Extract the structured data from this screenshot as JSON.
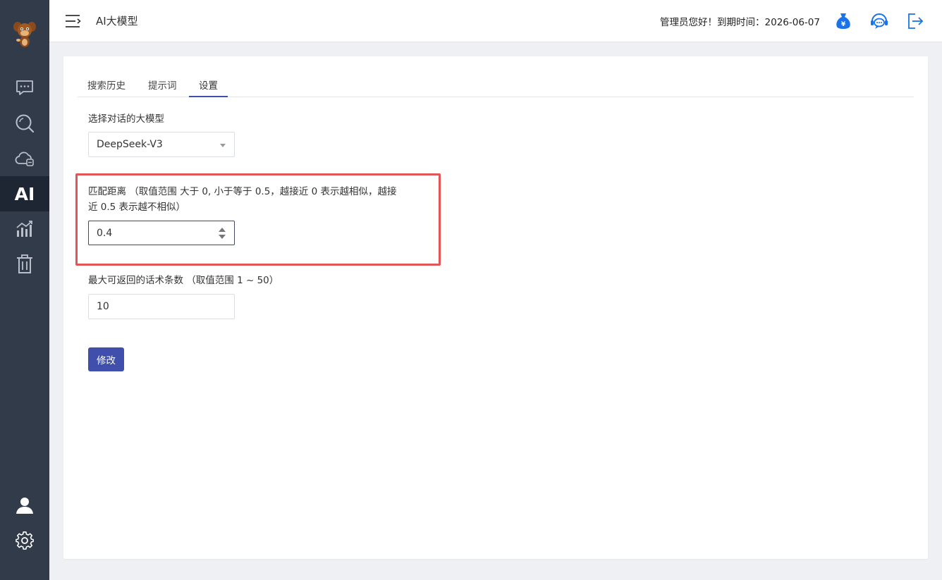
{
  "header": {
    "title": "AI大模型",
    "greeting": "管理员您好！到期时间：2026-06-07"
  },
  "sidebar": {
    "items": [
      {
        "icon": "chat-icon"
      },
      {
        "icon": "search-icon"
      },
      {
        "icon": "cloud-icon"
      },
      {
        "icon": "ai-icon",
        "label": "AI",
        "active": true
      },
      {
        "icon": "chart-icon"
      },
      {
        "icon": "trash-icon"
      }
    ],
    "bottom": [
      {
        "icon": "user-icon"
      },
      {
        "icon": "gear-icon"
      }
    ]
  },
  "tabs": [
    {
      "label": "搜索历史"
    },
    {
      "label": "提示词"
    },
    {
      "label": "设置",
      "active": true
    }
  ],
  "form": {
    "model_label": "选择对话的大模型",
    "model_value": "DeepSeek-V3",
    "distance_label_line1": "匹配距离 （取值范围 大于 0, 小于等于 0.5，越接近 0 表示越相似，越接",
    "distance_label_line2": "近 0.5 表示越不相似）",
    "distance_value": "0.4",
    "max_label": "最大可返回的话术条数 （取值范围 1 ~ 50）",
    "max_value": "10",
    "submit_label": "修改"
  },
  "colors": {
    "sidebar_bg": "#323b4a",
    "accent": "#3f4fab",
    "highlight": "#e05555"
  }
}
